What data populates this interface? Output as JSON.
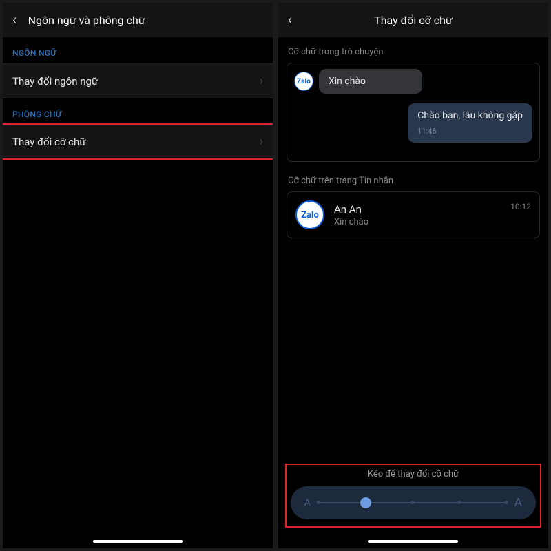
{
  "left": {
    "headerTitle": "Ngôn ngữ và phông chữ",
    "sectionLanguage": "NGÔN NGỮ",
    "changeLanguage": "Thay đổi ngôn ngữ",
    "sectionFont": "PHÔNG CHỮ",
    "changeFontSize": "Thay đổi cỡ chữ"
  },
  "right": {
    "headerTitle": "Thay đổi cỡ chữ",
    "chatPreviewLabel": "Cỡ chữ trong trò chuyện",
    "chatIn": "Xin chào",
    "chatOut": "Chào bạn, lâu không gặp",
    "chatOutTime": "11:46",
    "listPreviewLabel": "Cỡ chữ trên trang Tin nhắn",
    "contactName": "An An",
    "contactPreview": "Xin chào",
    "contactTime": "10:12",
    "sliderLabel": "Kéo để thay đổi cỡ chữ",
    "sliderSmall": "A",
    "sliderLarge": "A",
    "avatarText": "Zalo"
  }
}
